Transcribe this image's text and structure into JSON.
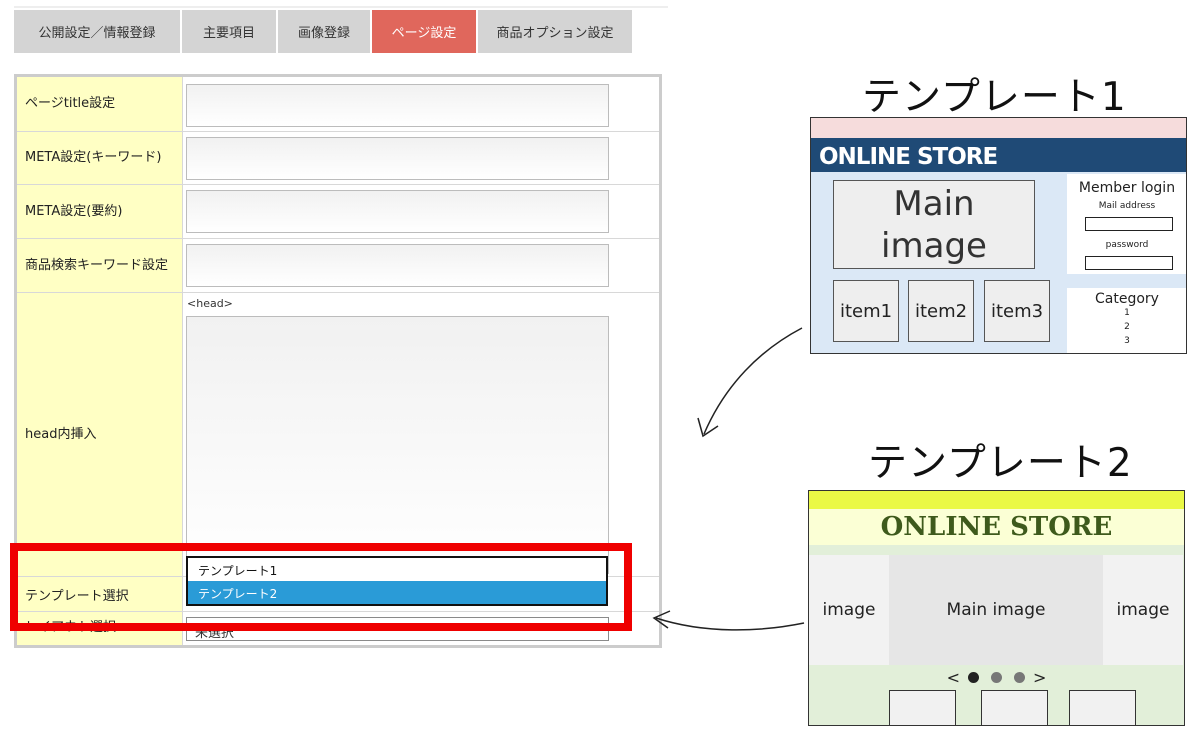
{
  "tabs": [
    {
      "label": "公開設定／情報登録",
      "active": false
    },
    {
      "label": "主要項目",
      "active": false
    },
    {
      "label": "画像登録",
      "active": false
    },
    {
      "label": "ページ設定",
      "active": true
    },
    {
      "label": "商品オプション設定",
      "active": false
    }
  ],
  "form": {
    "rows": [
      {
        "label": "ページtitle設定"
      },
      {
        "label": "META設定(キーワード)"
      },
      {
        "label": "META設定(要約)"
      },
      {
        "label": "商品検索キーワード設定"
      },
      {
        "label": "head内挿入",
        "prefix": "<head>"
      },
      {
        "label": "テンプレート選択"
      },
      {
        "label": "レイアウト選択"
      }
    ],
    "layout_select_value": "未選択",
    "template_dropdown": {
      "options": [
        "テンプレート1",
        "テンプレート2"
      ],
      "selected": "テンプレート2"
    }
  },
  "templates": {
    "t1": {
      "title": "テンプレート1",
      "header": "ONLINE STORE",
      "main_image": "Main image",
      "items": [
        "item1",
        "item2",
        "item3"
      ],
      "member_login": "Member login",
      "mail_label": "Mail address",
      "password_label": "password",
      "category_title": "Category",
      "categories": [
        "1",
        "2",
        "3"
      ]
    },
    "t2": {
      "title": "テンプレート2",
      "header": "ONLINE STORE",
      "left_image": "image",
      "main_image": "Main image",
      "right_image": "image",
      "nav_prev": "<",
      "nav_next": ">"
    }
  },
  "colors": {
    "tab_active": "#e0675c",
    "label_bg": "#ffffc4",
    "highlight": "#ef0000",
    "selected_option": "#2a9bd7",
    "t1_header": "#1f4a76",
    "t2_header_text": "#3e5a1c"
  }
}
